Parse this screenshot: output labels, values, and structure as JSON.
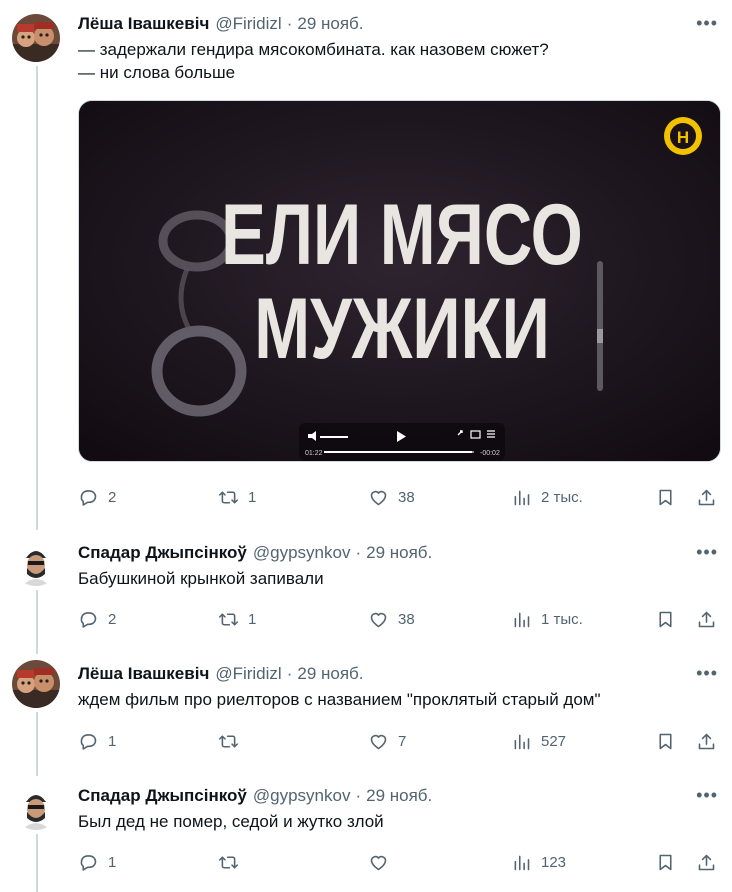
{
  "tweets": [
    {
      "name": "Лёша Івашкевіч",
      "handle": "@Firidizl",
      "date": "29 нояб.",
      "lines": [
        "— задержали гендира мясокомбината. как назовем сюжет?",
        "— ни слова больше"
      ],
      "media": {
        "title_line1": "ЕЛИ МЯСО",
        "title_line2": "МУЖИКИ",
        "logo": "Н",
        "time_elapsed": "01:22",
        "time_remaining": "-00:02"
      },
      "replies": "2",
      "retweets": "1",
      "likes": "38",
      "views": "2 тыс."
    },
    {
      "name": "Спадар Джыпсінкоў",
      "handle": "@gypsynkov",
      "date": "29 нояб.",
      "lines": [
        "Бабушкиной крынкой запивали"
      ],
      "replies": "2",
      "retweets": "1",
      "likes": "38",
      "views": "1 тыс."
    },
    {
      "name": "Лёша Івашкевіч",
      "handle": "@Firidizl",
      "date": "29 нояб.",
      "lines": [
        "ждем фильм про риелторов с названием \"проклятый старый дом\""
      ],
      "replies": "1",
      "retweets": "",
      "likes": "7",
      "views": "527"
    },
    {
      "name": "Спадар Джыпсінкоў",
      "handle": "@gypsynkov",
      "date": "29 нояб.",
      "lines": [
        "Был дед не помер, седой и жутко злой"
      ],
      "replies": "1",
      "retweets": "",
      "likes": "",
      "views": "123"
    }
  ],
  "colors": {
    "text": "#0f1419",
    "secondary": "#536471",
    "thread_line": "#cfd9de",
    "logo_yellow": "#f2c200"
  },
  "icons": {
    "more": "more-icon",
    "reply": "reply-icon",
    "retweet": "retweet-icon",
    "like": "like-icon",
    "views": "views-icon",
    "bookmark": "bookmark-icon",
    "share": "share-icon"
  }
}
